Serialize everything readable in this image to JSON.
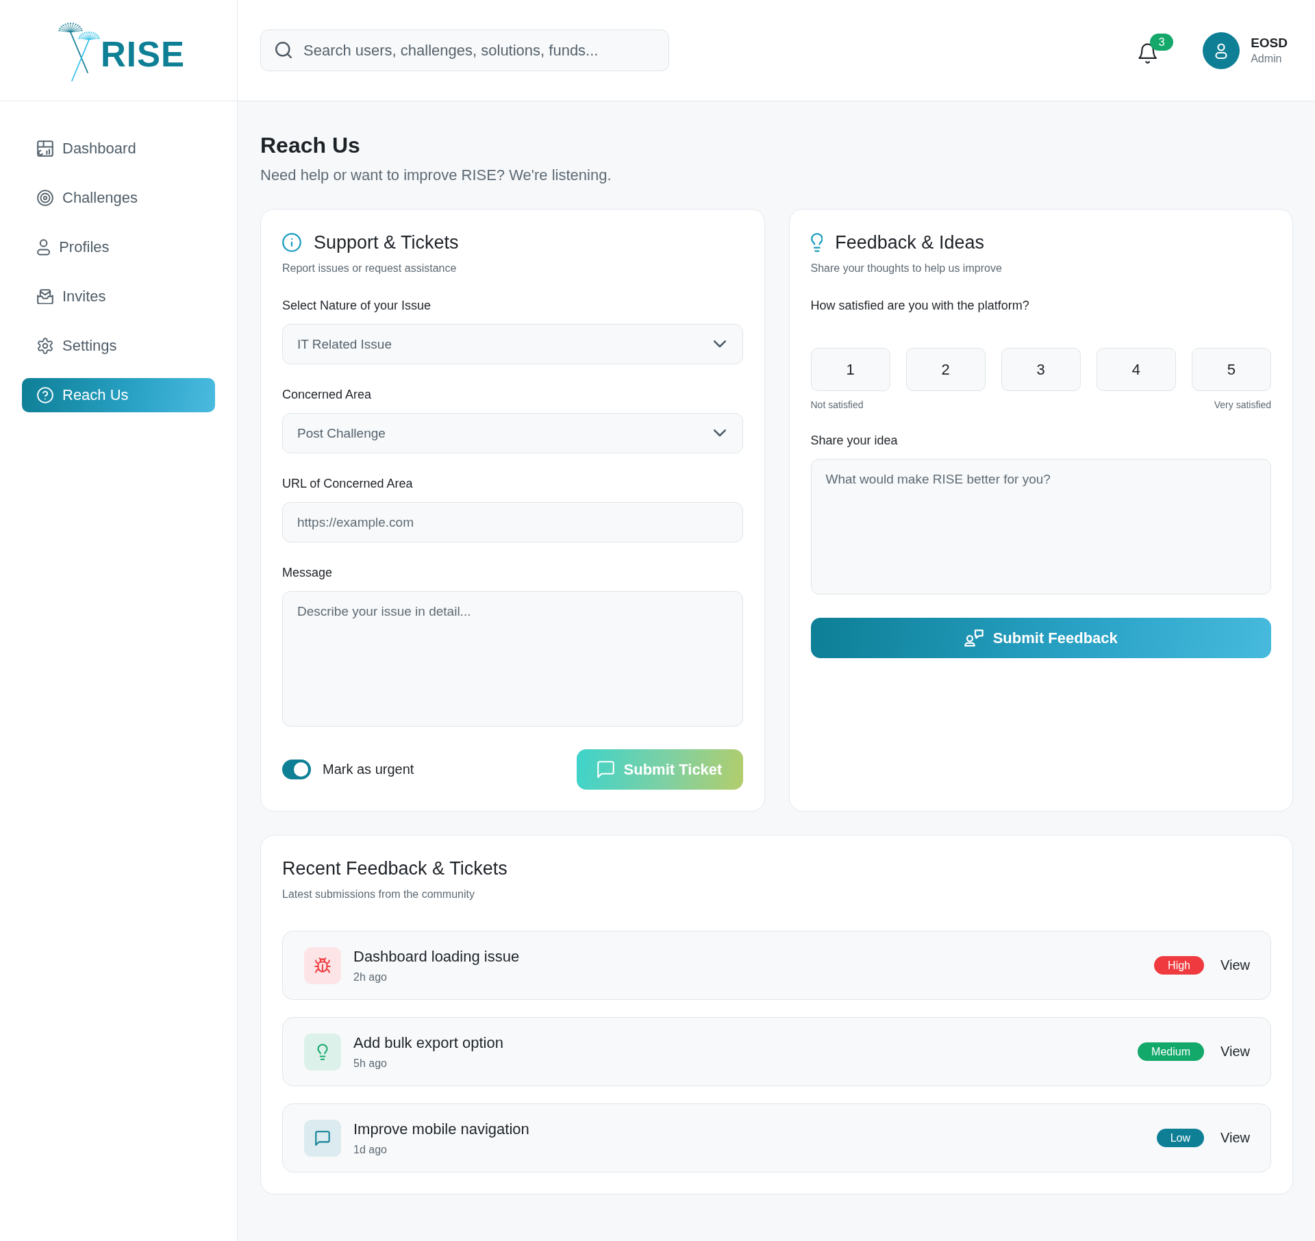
{
  "logo": {
    "text": "RISE"
  },
  "sidebar": {
    "items": [
      {
        "label": "Dashboard",
        "selected": false
      },
      {
        "label": "Challenges",
        "selected": false
      },
      {
        "label": "Profiles",
        "selected": false
      },
      {
        "label": "Invites",
        "selected": false
      },
      {
        "label": "Settings",
        "selected": false
      },
      {
        "label": "Reach Us",
        "selected": true
      }
    ]
  },
  "search": {
    "placeholder": "Search users, challenges, solutions, funds..."
  },
  "notifications": {
    "count": "3"
  },
  "user": {
    "name": "EOSD",
    "role": "Admin"
  },
  "page": {
    "title": "Reach Us",
    "subtitle": "Need help or want to improve RISE? We're listening."
  },
  "support": {
    "title": "Support & Tickets",
    "subtitle": "Report issues or request assistance",
    "fields": [
      {
        "kind": "select",
        "label": "Select Nature of your Issue",
        "value": "IT Related Issue"
      },
      {
        "kind": "select",
        "label": "Concerned Area",
        "value": "Post Challenge"
      },
      {
        "kind": "input",
        "label": "URL of Concerned Area",
        "placeholder": "https://example.com"
      },
      {
        "kind": "textarea",
        "label": "Message",
        "placeholder": "Describe your issue in detail..."
      }
    ],
    "urgent": {
      "label": "Mark as urgent",
      "on": true
    },
    "submit": "Submit Ticket"
  },
  "feedback": {
    "title": "Feedback & Ideas",
    "subtitle": "Share your thoughts to help us improve",
    "question": "How satisfied are you with the platform?",
    "ratings": [
      {
        "label": "1",
        "selected": false
      },
      {
        "label": "2",
        "selected": false
      },
      {
        "label": "3",
        "selected": false
      },
      {
        "label": "4",
        "selected": false
      },
      {
        "label": "5",
        "selected": false
      }
    ],
    "scale_low": "Not satisfied",
    "scale_high": "Very satisfied",
    "idea": {
      "label": "Share your idea",
      "placeholder": "What would make RISE better for you?"
    },
    "submit": "Submit Feedback"
  },
  "recent": {
    "title": "Recent Feedback & Tickets",
    "subtitle": "Latest submissions from the community",
    "items": [
      {
        "kind": "issue",
        "title": "Dashboard loading issue",
        "time": "2h ago",
        "priority": "High",
        "color": "#ef3b3f",
        "action": "View"
      },
      {
        "kind": "idea",
        "title": "Add bulk export option",
        "time": "5h ago",
        "priority": "Medium",
        "color": "#12a96b",
        "action": "View"
      },
      {
        "kind": "feedback",
        "title": "Improve mobile navigation",
        "time": "1d ago",
        "priority": "Low",
        "color": "#0e7f95",
        "action": "View"
      }
    ]
  }
}
